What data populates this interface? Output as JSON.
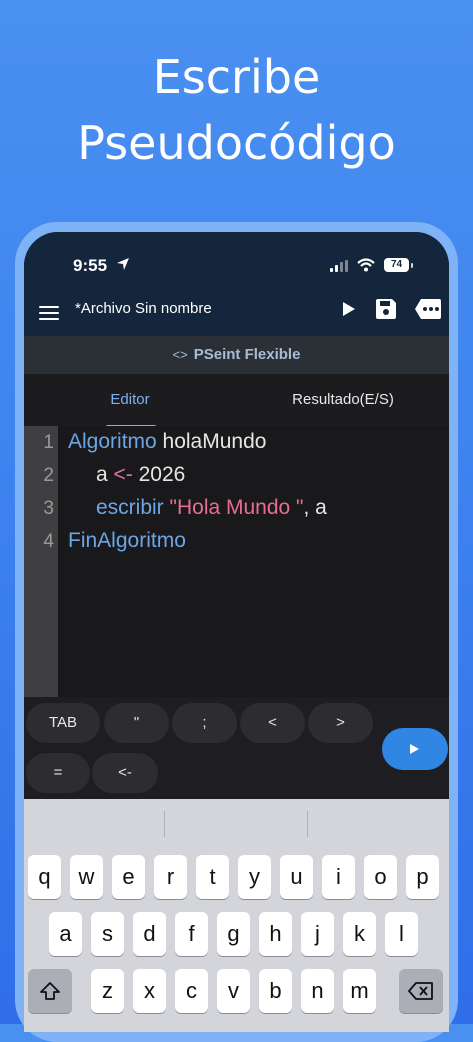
{
  "headline": {
    "line1": "Escribe",
    "line2": "Pseudocódigo"
  },
  "status_bar": {
    "time": "9:55",
    "battery": "74"
  },
  "toolbar": {
    "file_title": "*Archivo Sin nombre"
  },
  "app": {
    "name": "PSeint Flexible"
  },
  "tabs": {
    "editor": "Editor",
    "result": "Resultado(E/S)"
  },
  "editor": {
    "line_numbers": [
      "1",
      "2",
      "3",
      "4"
    ],
    "code": {
      "l1_kw": "Algoritmo",
      "l1_name": " holaMundo",
      "l2_var": "a ",
      "l2_op": "<-",
      "l2_val": " 2026",
      "l3_kw": "escribir",
      "l3_str": " \"Hola Mundo \"",
      "l3_rest": ", a",
      "l4_kw": "FinAlgoritmo"
    }
  },
  "shortcut_keys": [
    "TAB",
    "\"",
    ";",
    "<",
    ">",
    "=",
    "<-"
  ],
  "keyboard": {
    "row1": [
      "q",
      "w",
      "e",
      "r",
      "t",
      "y",
      "u",
      "i",
      "o",
      "p"
    ],
    "row2": [
      "a",
      "s",
      "d",
      "f",
      "g",
      "h",
      "j",
      "k",
      "l"
    ],
    "row3": [
      "z",
      "x",
      "c",
      "v",
      "b",
      "n",
      "m"
    ]
  },
  "colors": {
    "background": "#3f83ef",
    "accent": "#2f86e3",
    "keyword": "#6ca6e6",
    "string": "#e86d8f",
    "toolbar": "#14263b"
  },
  "icons": [
    "location-arrow-icon",
    "signal-icon",
    "wifi-icon",
    "battery-icon",
    "menu-icon",
    "play-icon",
    "save-icon",
    "more-icon",
    "code-icon",
    "run-icon",
    "shift-icon",
    "backspace-icon"
  ]
}
